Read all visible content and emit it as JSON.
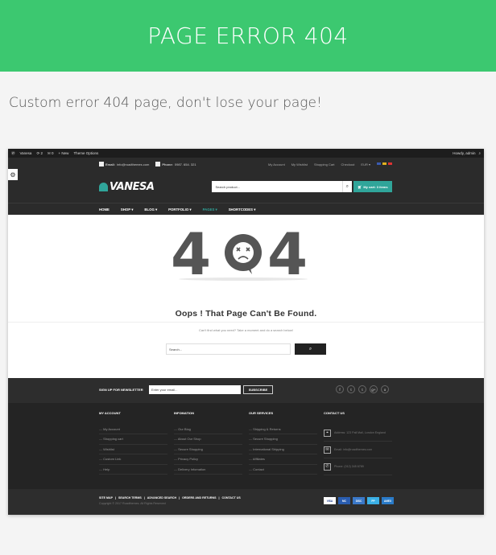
{
  "banner": {
    "title": "PAGE ERROR 404"
  },
  "subtitle": "Custom error 404 page, don't lose your page!",
  "adminbar": {
    "site": "Vanesa",
    "updates": "2",
    "comments": "0",
    "new": "New",
    "theme_options": "Theme Options",
    "greeting": "Howdy, admin"
  },
  "topbar": {
    "email_label": "Email:",
    "email": "info@roadthemes.com",
    "phone_label": "Phone:",
    "phone": "0987. 654. 321",
    "links": [
      "My Account",
      "My Wishlist",
      "Shopping Cart",
      "Checkout"
    ],
    "currency": "EUR"
  },
  "header": {
    "logo": "VANESA",
    "search_placeholder": "Search product...",
    "cart": "My cart: 3 items"
  },
  "nav": {
    "items": [
      "HOME",
      "SHOP",
      "BLOG",
      "PORTFOLIO",
      "PAGES",
      "SHORTCODES"
    ]
  },
  "error": {
    "code_left": "4",
    "code_right": "4",
    "heading": "Oops ! That Page Can't Be Found.",
    "message": "Can't find what you need? Take a moment and do a search below!",
    "search_placeholder": "Search..."
  },
  "newsletter": {
    "label": "SIGN UP FOR NEWSLETTER",
    "placeholder": "Enter your email...",
    "button": "SUBSCRIBE"
  },
  "socials": [
    "f",
    "t",
    "t",
    "g+",
    "o"
  ],
  "footer": {
    "columns": [
      {
        "title": "MY ACCOUNT",
        "items": [
          "My Account",
          "Shopping cart",
          "Wishlist",
          "Custom Link",
          "Help"
        ]
      },
      {
        "title": "INFOMATION",
        "items": [
          "Our Blog",
          "About Our Shop",
          "Secure Shopping",
          "Privacy Policy",
          "Delivery Infomation"
        ]
      },
      {
        "title": "OUR SERVICES",
        "items": [
          "Shipping & Returns",
          "Secure Shopping",
          "International Shipping",
          "Affiliates",
          "Contact"
        ]
      }
    ],
    "contact": {
      "title": "CONTACT US",
      "address": "Address: 123 Pall Mall, London England",
      "email": "Email: info@roadthemes.com",
      "phone": "Phone: (012) 345 6789"
    }
  },
  "bottom": {
    "links": [
      "SITE MAP",
      "SEARCH TERMS",
      "ADVANCED SEARCH",
      "ORDERS AND RETURNS",
      "CONTACT US"
    ],
    "copyright": "Copyright © 2017 Roadthemes. All Rights Reserved",
    "cards": [
      "VISA",
      "MC",
      "DISC",
      "PP",
      "AMEX"
    ]
  },
  "colors": {
    "banner": "#3cc870",
    "accent": "#30a59a",
    "dark": "#2b2b2b"
  }
}
